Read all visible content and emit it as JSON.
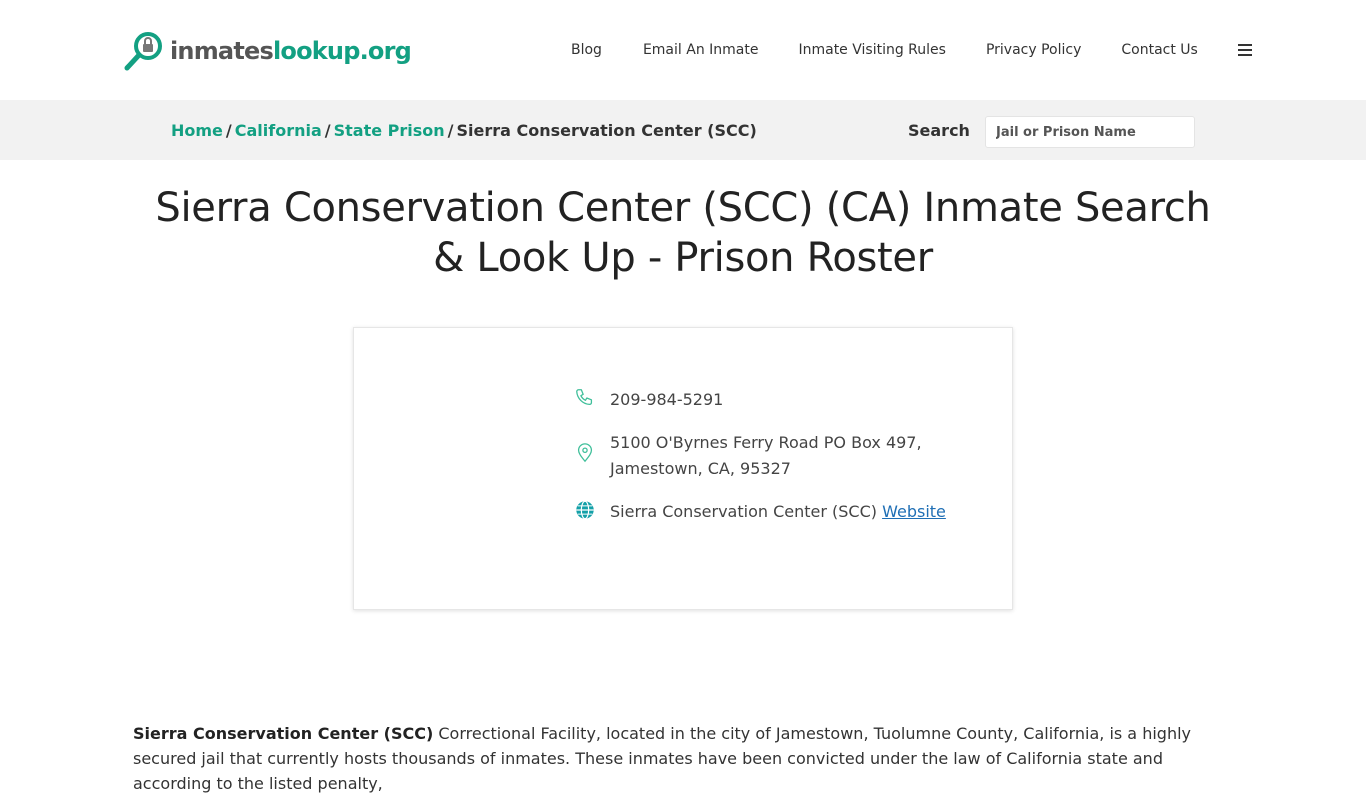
{
  "header": {
    "logo": {
      "part1": "inmates",
      "part2": "lookup.org"
    },
    "nav": [
      {
        "label": "Blog"
      },
      {
        "label": "Email An Inmate"
      },
      {
        "label": "Inmate Visiting Rules"
      },
      {
        "label": "Privacy Policy"
      },
      {
        "label": "Contact Us"
      }
    ],
    "menu_icon": "hamburger-icon"
  },
  "breadcrumb": {
    "home": "Home",
    "state": "California",
    "type": "State Prison",
    "current": "Sierra Conservation Center (SCC)",
    "separator": "/"
  },
  "search": {
    "label": "Search",
    "placeholder": "Jail or Prison Name"
  },
  "page": {
    "title": "Sierra Conservation Center (SCC) (CA) Inmate Search & Look Up - Prison Roster"
  },
  "facility": {
    "phone": "209-984-5291",
    "address_line1": "5100 O'Byrnes Ferry Road PO Box 497,",
    "address_line2": "Jamestown, CA, 95327",
    "website_prefix": "Sierra Conservation Center (SCC)",
    "website_link": "Website"
  },
  "description": {
    "bold": "Sierra Conservation Center (SCC)",
    "text": " Correctional Facility, located in the city of Jamestown, Tuolumne County, California, is a highly secured jail that currently hosts thousands of inmates. These inmates have been convicted under the law of California state and according to the listed penalty,"
  },
  "colors": {
    "brand_green": "#13a082",
    "link_blue": "#1f6fb5",
    "crumb_bg": "#f2f2f2"
  }
}
